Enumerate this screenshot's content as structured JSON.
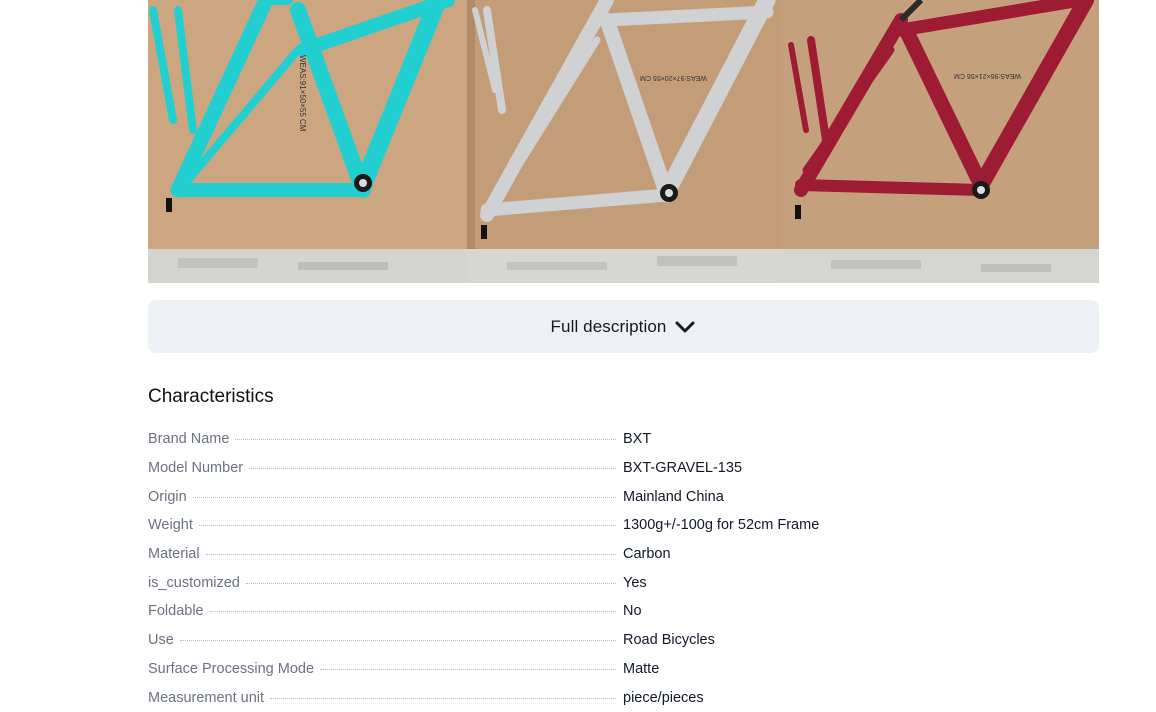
{
  "gallery": {
    "images": [
      {
        "name": "frame-photo-teal",
        "color": "#1fc8c8",
        "sticker": "WEAS:91×50×55 CM"
      },
      {
        "name": "frame-photo-silver",
        "color": "#c9cbcd",
        "sticker": "WEAS:97×20×55 CM"
      },
      {
        "name": "frame-photo-red",
        "color": "#9a1a30",
        "sticker": "WEAS:96×21×56 CM"
      }
    ]
  },
  "description_button": {
    "label": "Full description"
  },
  "characteristics": {
    "title": "Characteristics",
    "rows": [
      {
        "key": "Brand Name",
        "value": "BXT"
      },
      {
        "key": "Model Number",
        "value": "BXT-GRAVEL-135"
      },
      {
        "key": "Origin",
        "value": "Mainland China"
      },
      {
        "key": "Weight",
        "value": "1300g+/-100g for 52cm Frame"
      },
      {
        "key": "Material",
        "value": "Carbon"
      },
      {
        "key": "is_customized",
        "value": "Yes"
      },
      {
        "key": "Foldable",
        "value": "No"
      },
      {
        "key": "Use",
        "value": "Road Bicycles"
      },
      {
        "key": "Surface Processing Mode",
        "value": "Matte"
      },
      {
        "key": "Measurement unit",
        "value": "piece/pieces"
      }
    ]
  }
}
